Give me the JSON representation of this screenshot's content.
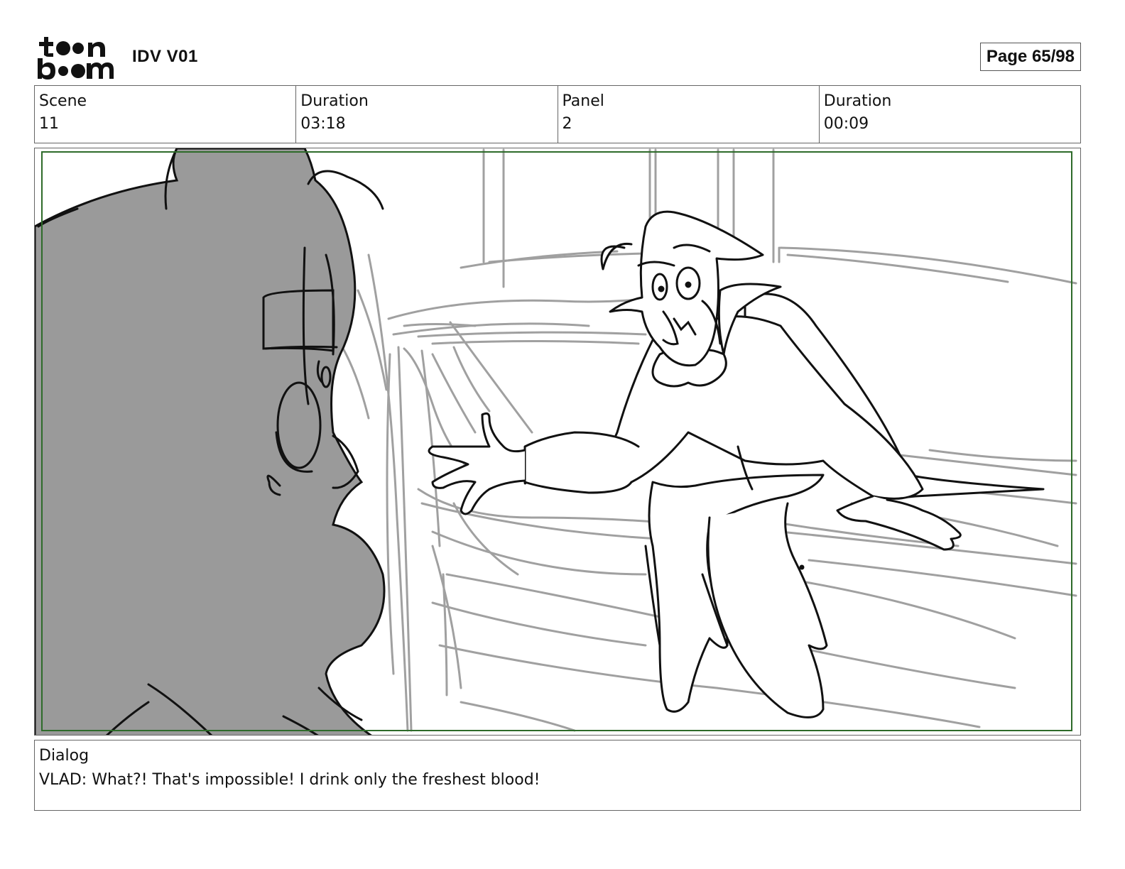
{
  "header": {
    "logo_alt": "toon boom",
    "project_title": "IDV V01",
    "page_indicator": "Page 65/98"
  },
  "info": {
    "scene_label": "Scene",
    "scene_value": "11",
    "scene_duration_label": "Duration",
    "scene_duration_value": "03:18",
    "panel_label": "Panel",
    "panel_value": "2",
    "panel_duration_label": "Duration",
    "panel_duration_value": "00:09"
  },
  "dialog": {
    "label": "Dialog",
    "text": "VLAD: What?! That's impossible! I drink only the freshest blood!"
  },
  "colors": {
    "frame_border": "#666666",
    "safe_area": "#2e6b2a",
    "silhouette_fill": "#9a9a9a",
    "sketch_gray": "#a0a0a0",
    "ink": "#111111"
  }
}
